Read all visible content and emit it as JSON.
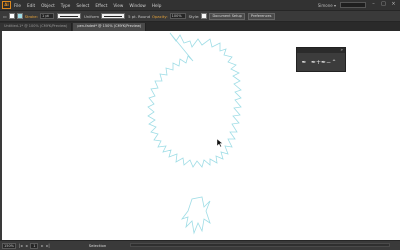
{
  "menubar": {
    "logo": "Ai",
    "items": [
      "File",
      "Edit",
      "Object",
      "Type",
      "Select",
      "Effect",
      "View",
      "Window",
      "Help"
    ],
    "workspace": "Simone ▾"
  },
  "controlbar": {
    "stroke_label": "Stroke:",
    "stroke_weight": "1 pt",
    "profile_label": "Uniform",
    "brush_label": "5 pt. Round",
    "opacity_label": "Opacity:",
    "opacity_value": "100%",
    "style_label": "Style:",
    "doc_setup": "Document Setup",
    "preferences": "Preferences",
    "fill_color": "#e8a43a",
    "stroke_color": "#9fdde6"
  },
  "tabs": [
    {
      "label": "Untitled-1* @ 100% (CMYK/Preview)",
      "active": false
    },
    {
      "label": "pen-faded* @ 150% (CMYK/Preview)",
      "active": true
    }
  ],
  "float_panel": {
    "tools": [
      "✒",
      "✒+",
      "✒−",
      "⌃"
    ]
  },
  "statusbar": {
    "zoom": "150%",
    "page": "1",
    "status": "Selection"
  },
  "colors": {
    "outline_stroke": "#9fdde6"
  }
}
